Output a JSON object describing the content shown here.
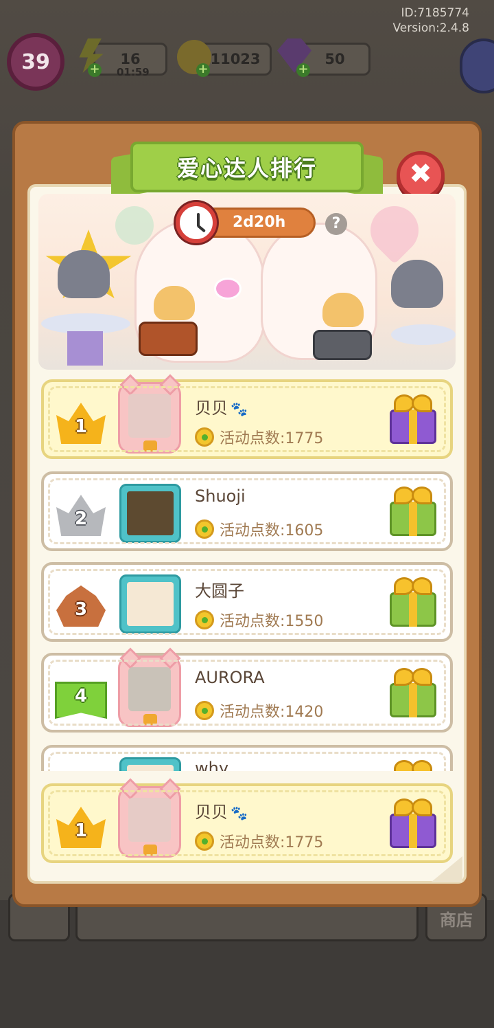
{
  "meta": {
    "id": "ID:7185774",
    "version": "Version:2.4.8"
  },
  "hud": {
    "level": "39",
    "energy": "16",
    "energy_timer": "01:59",
    "coins": "11023",
    "gems": "50"
  },
  "background": {
    "shop_label": "商店"
  },
  "panel": {
    "title": "爱心达人排行",
    "timer": "2d20h",
    "help": "?",
    "close": "✖"
  },
  "colors": {
    "panel_brown": "#b87a45",
    "title_green": "#9fcf48",
    "close_red": "#e85454",
    "timer_orange": "#e0813e",
    "self_row_yellow": "#fff8cc"
  },
  "leaderboard": [
    {
      "rank": "1",
      "name": "贝贝",
      "paw": "🐾",
      "points": "活动点数:1775",
      "badge": "gold-crown",
      "reward": "purple-gift"
    },
    {
      "rank": "2",
      "name": "Shuoji",
      "paw": "",
      "points": "活动点数:1605",
      "badge": "silver-crown",
      "reward": "green-gift"
    },
    {
      "rank": "3",
      "name": "大圆子",
      "paw": "",
      "points": "活动点数:1550",
      "badge": "bronze-crown",
      "reward": "green-gift"
    },
    {
      "rank": "4",
      "name": "AURORA",
      "paw": "",
      "points": "活动点数:1420",
      "badge": "green-flag",
      "reward": "green-gift"
    },
    {
      "rank": "",
      "name": "why",
      "paw": "",
      "points": "",
      "badge": "green-flag",
      "reward": "green-gift"
    }
  ],
  "my_rank": {
    "rank": "1",
    "name": "贝贝",
    "paw": "🐾",
    "points": "活动点数:1775"
  }
}
